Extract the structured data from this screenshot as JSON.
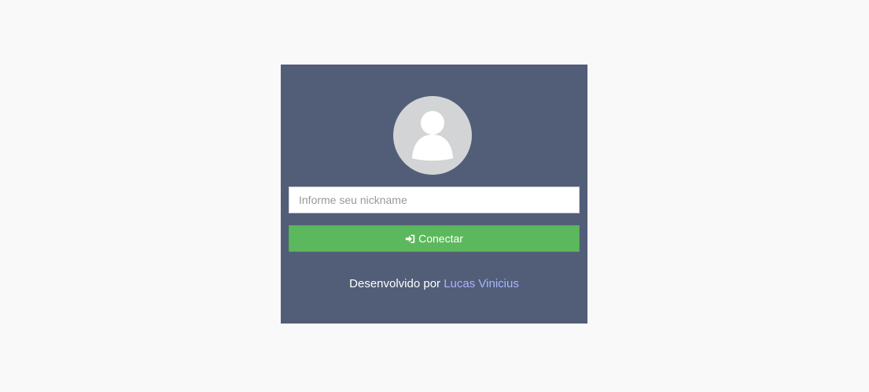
{
  "login": {
    "avatar_icon": "user-silhouette-icon",
    "nickname_placeholder": "Informe seu nickname",
    "nickname_value": "",
    "connect_icon": "sign-in-icon",
    "connect_label": "Conectar",
    "credit_prefix": "Desenvolvido por ",
    "credit_author": "Lucas Vinicius"
  },
  "colors": {
    "page_background": "#f9f9f9",
    "card_background": "#525e78",
    "avatar_background": "#d3d4d6",
    "button_background": "#5cb85c",
    "link_color": "#a9b4ff"
  }
}
